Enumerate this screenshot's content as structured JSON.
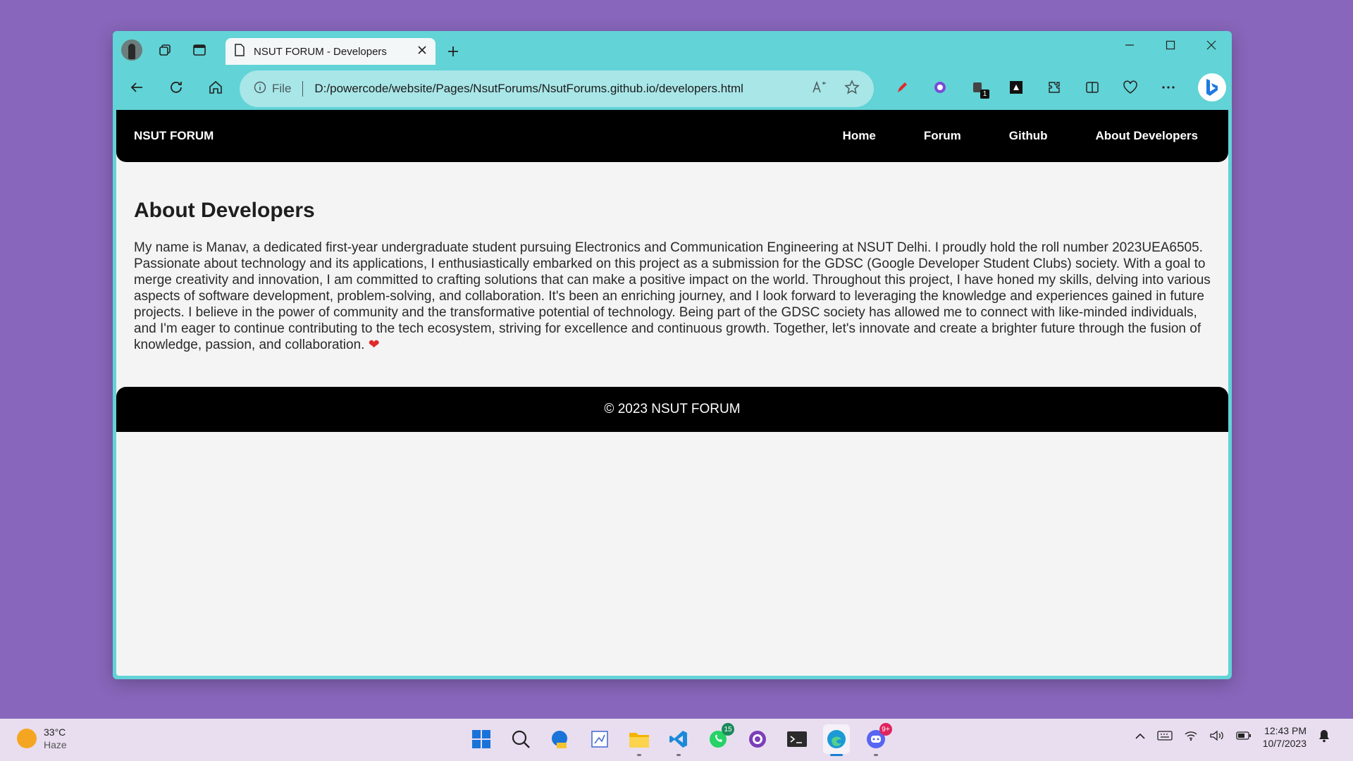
{
  "browser": {
    "tab_title": "NSUT FORUM - Developers",
    "address_scheme": "File",
    "url": "D:/powercode/website/Pages/NsutForums/NsutForums.github.io/developers.html"
  },
  "site": {
    "brand": "NSUT FORUM",
    "nav": [
      "Home",
      "Forum",
      "Github",
      "About Developers"
    ],
    "heading": "About Developers",
    "body": "My name is Manav, a dedicated first-year undergraduate student pursuing Electronics and Communication Engineering at NSUT Delhi. I proudly hold the roll number 2023UEA6505. Passionate about technology and its applications, I enthusiastically embarked on this project as a submission for the GDSC (Google Developer Student Clubs) society. With a goal to merge creativity and innovation, I am committed to crafting solutions that can make a positive impact on the world. Throughout this project, I have honed my skills, delving into various aspects of software development, problem-solving, and collaboration. It's been an enriching journey, and I look forward to leveraging the knowledge and experiences gained in future projects. I believe in the power of community and the transformative potential of technology. Being part of the GDSC society has allowed me to connect with like-minded individuals, and I'm eager to continue contributing to the tech ecosystem, striving for excellence and continuous growth. Together, let's innovate and create a brighter future through the fusion of knowledge, passion, and collaboration.",
    "heart": "❤",
    "footer": "© 2023 NSUT FORUM"
  },
  "taskbar": {
    "weather_temp": "33°C",
    "weather_desc": "Haze",
    "whatsapp_badge": "15",
    "discord_badge": "9+",
    "time": "12:43 PM",
    "date": "10/7/2023",
    "ext_badge": "1"
  },
  "colors": {
    "window_frame": "#62d3d6",
    "address_bar": "#a8e6e8",
    "desktop": "#8866bb",
    "site_bar": "#000000"
  }
}
